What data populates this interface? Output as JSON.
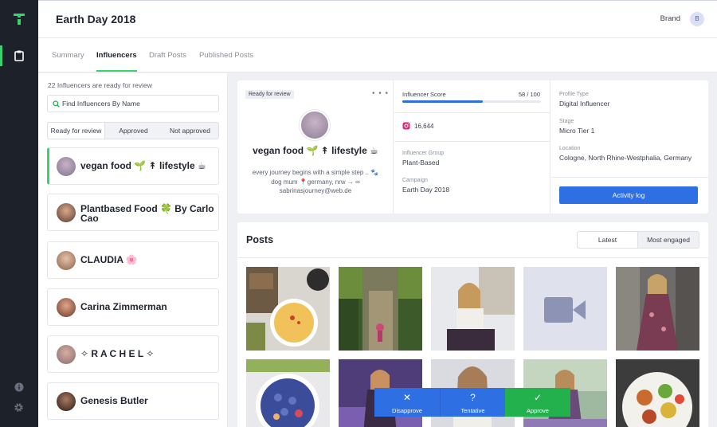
{
  "header": {
    "title": "Earth Day 2018",
    "brand": "Brand",
    "avatar_initial": "B"
  },
  "tabs": [
    {
      "label": "Summary"
    },
    {
      "label": "Influencers"
    },
    {
      "label": "Draft Posts"
    },
    {
      "label": "Published Posts"
    }
  ],
  "active_tab": "Influencers",
  "list": {
    "count_text": "22 Influencers are ready for review",
    "search_placeholder": "Find Influencers By Name",
    "filters": [
      "Ready for review",
      "Approved",
      "Not approved"
    ],
    "active_filter": "Ready for review",
    "influencers": [
      {
        "name": "vegan food 🌱 ↟ lifestyle ☕"
      },
      {
        "name": "Plantbased Food 🍀 By Carlo Cao"
      },
      {
        "name": "CLAUDIA 🌸"
      },
      {
        "name": "Carina Zimmerman"
      },
      {
        "name": "✧ R A C H E L ✧"
      },
      {
        "name": "Genesis Butler"
      }
    ]
  },
  "profile": {
    "status_badge": "Ready for review",
    "more": "• • •",
    "name": "vegan food 🌱 ↟ lifestyle ☕",
    "bio": "every journey begins with a simple step .. 🐾 dog mum 📍germany, nrw → ∞ sabrinasjourney@web.de",
    "score_label": "Influencer Score",
    "score_text": "58 / 100",
    "score": 58,
    "score_max": 100,
    "followers": "16,644",
    "group_label": "Influencer Group",
    "group": "Plant-Based",
    "campaign_label": "Campaign",
    "campaign": "Earth Day 2018",
    "type_label": "Profile Type",
    "type": "Digital Influencer",
    "stage_label": "Stage",
    "stage": "Micro Tier 1",
    "location_label": "Location",
    "location": "Cologne, North Rhine-Westphalia, Germany",
    "activity_button": "Activity log"
  },
  "posts": {
    "title": "Posts",
    "sort_options": [
      "Latest",
      "Most engaged"
    ],
    "active_sort": "Latest"
  },
  "actions": {
    "disapprove": "Disapprove",
    "tentative": "Tentative",
    "approve": "Approve"
  },
  "colors": {
    "accent_green": "#3bd16f",
    "primary_blue": "#2f6fe4",
    "approve_green": "#22b14c",
    "rail": "#1d2129"
  }
}
